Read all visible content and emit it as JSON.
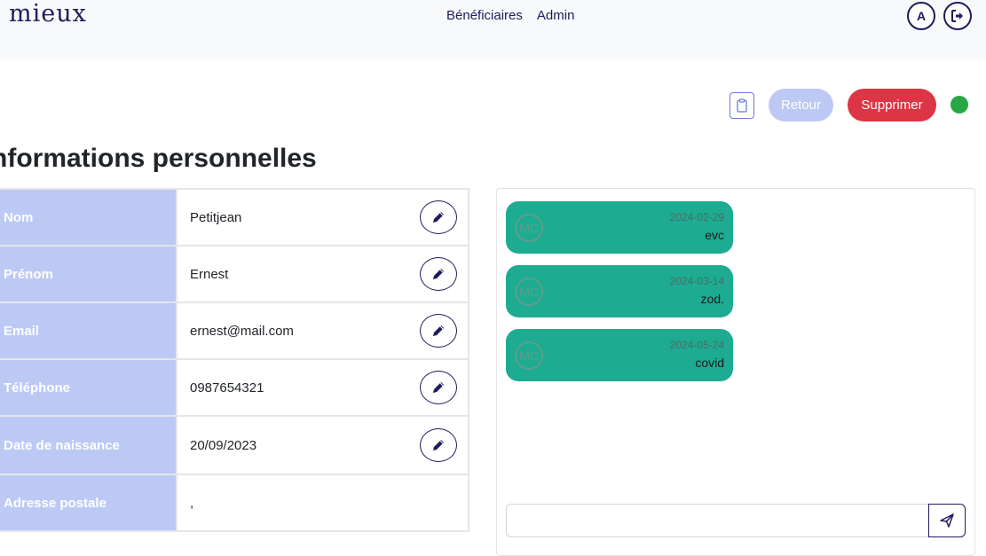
{
  "header": {
    "logo": "mieux",
    "nav": [
      {
        "label": "Bénéficiaires"
      },
      {
        "label": "Admin"
      }
    ],
    "avatar_initial": "A",
    "logout_icon": "sign-out-icon"
  },
  "actions": {
    "clipboard_icon": "clipboard-icon",
    "retour_label": "Retour",
    "supprimer_label": "Supprimer",
    "status_color": "#28a745"
  },
  "title": "nformations personnelles",
  "fields": [
    {
      "label": "Nom",
      "value": "Petitjean",
      "editable": true
    },
    {
      "label": "Prénom",
      "value": "Ernest",
      "editable": true
    },
    {
      "label": "Email",
      "value": "ernest@mail.com",
      "editable": true
    },
    {
      "label": "Téléphone",
      "value": "0987654321",
      "editable": true
    },
    {
      "label": "Date de naissance",
      "value": "20/09/2023",
      "editable": true
    },
    {
      "label": "Adresse postale",
      "value": ",",
      "editable": false
    }
  ],
  "chat": {
    "messages": [
      {
        "initials": "MC",
        "date": "2024-02-29",
        "text": "evc"
      },
      {
        "initials": "MC",
        "date": "2024-03-14",
        "text": "zod."
      },
      {
        "initials": "MC",
        "date": "2024-05-24",
        "text": "covid"
      }
    ],
    "input_value": "",
    "input_placeholder": "",
    "send_icon": "send-icon"
  },
  "colors": {
    "primary": "#1e1b5e",
    "label_bg": "#bcc9f5",
    "danger": "#dc3545",
    "message_bg": "#1dab92"
  }
}
